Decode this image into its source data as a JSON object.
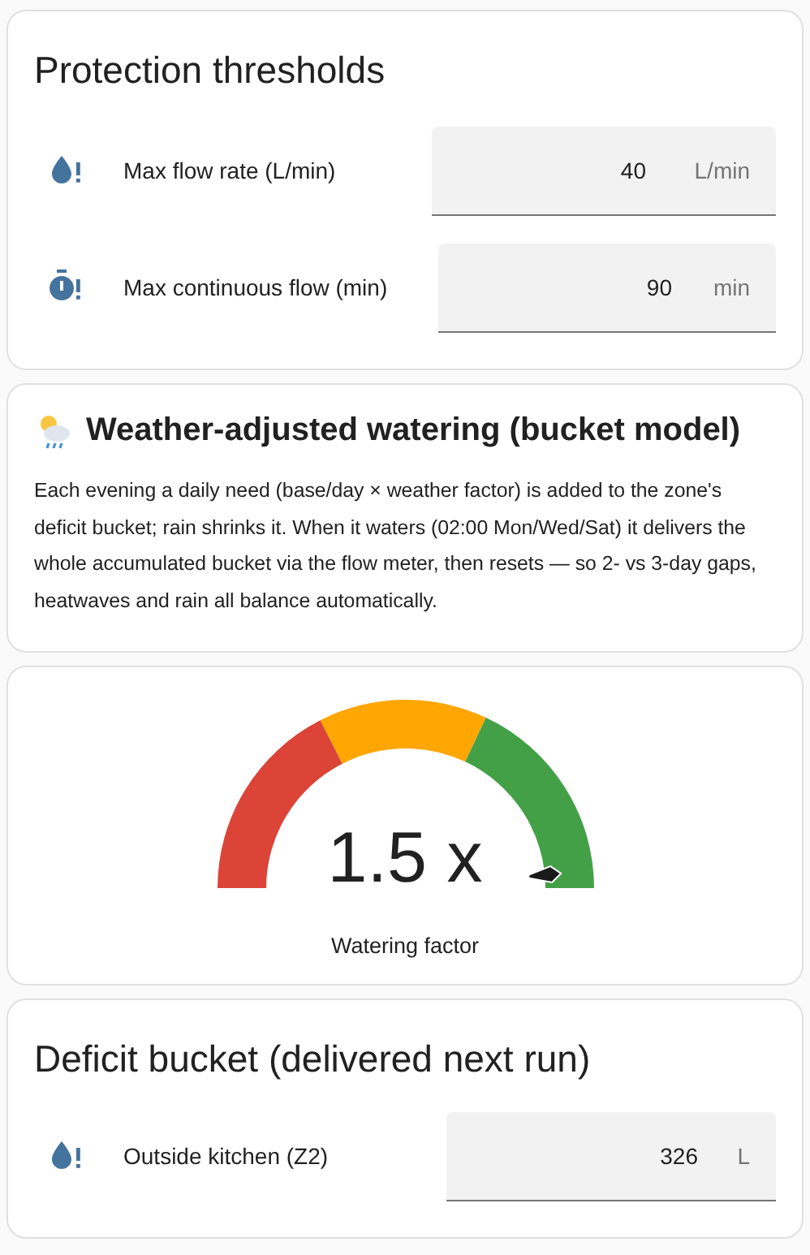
{
  "thresholds": {
    "title": "Protection thresholds",
    "rows": [
      {
        "kind": "drop",
        "label": "Max flow rate (L/min)",
        "value": "40",
        "unit": "L/min"
      },
      {
        "kind": "timer",
        "label": "Max continuous flow (min)",
        "value": "90",
        "unit": "min"
      }
    ]
  },
  "info": {
    "title": "Weather-adjusted watering (bucket model)",
    "text": "Each evening a daily need (base/day × weather factor) is added to the zone's deficit bucket; rain shrinks it. When it waters (02:00 Mon/Wed/Sat) it delivers the whole accumulated bucket via the flow meter, then resets — so 2- vs 3-day gaps, heatwaves and rain all balance automatically."
  },
  "gauge": {
    "value": "1.5 x",
    "label": "Watering factor",
    "segments": [
      {
        "color": "#db4437"
      },
      {
        "color": "#ffa600"
      },
      {
        "color": "#43a047"
      }
    ]
  },
  "deficit": {
    "title": "Deficit bucket (delivered next run)",
    "rows": [
      {
        "kind": "drop",
        "label": "Outside kitchen (Z2)",
        "value": "326",
        "unit": "L"
      }
    ]
  }
}
